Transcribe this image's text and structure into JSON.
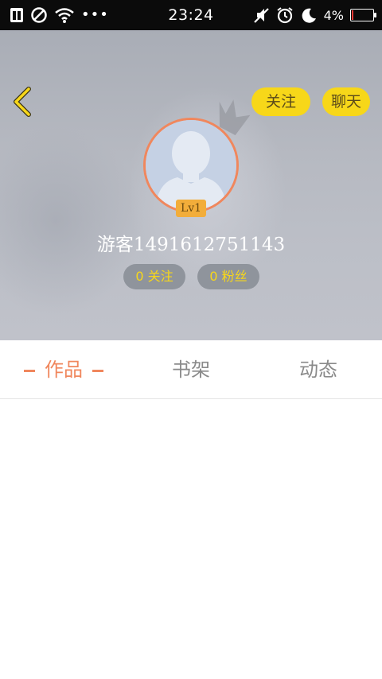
{
  "status_bar": {
    "time": "23:24",
    "battery_percent": "4%",
    "battery_level": 0.04,
    "left_icons": [
      "sim-card-icon",
      "blocked-icon",
      "wifi-icon",
      "more-dots-icon"
    ],
    "right_icons": [
      "mute-icon",
      "alarm-icon",
      "night-mode-icon",
      "battery-icon"
    ]
  },
  "header": {
    "follow_label": "关注",
    "chat_label": "聊天",
    "level_badge": "Lv1",
    "username": "游客1491612751143",
    "following_count": "0 关注",
    "fans_count": "0 粉丝",
    "colors": {
      "accent": "#f7d719",
      "avatar_ring": "#f0875d",
      "level_badge": "#f2ad3a"
    }
  },
  "tabs": [
    {
      "label": "作品",
      "active": true
    },
    {
      "label": "书架",
      "active": false
    },
    {
      "label": "动态",
      "active": false
    }
  ]
}
